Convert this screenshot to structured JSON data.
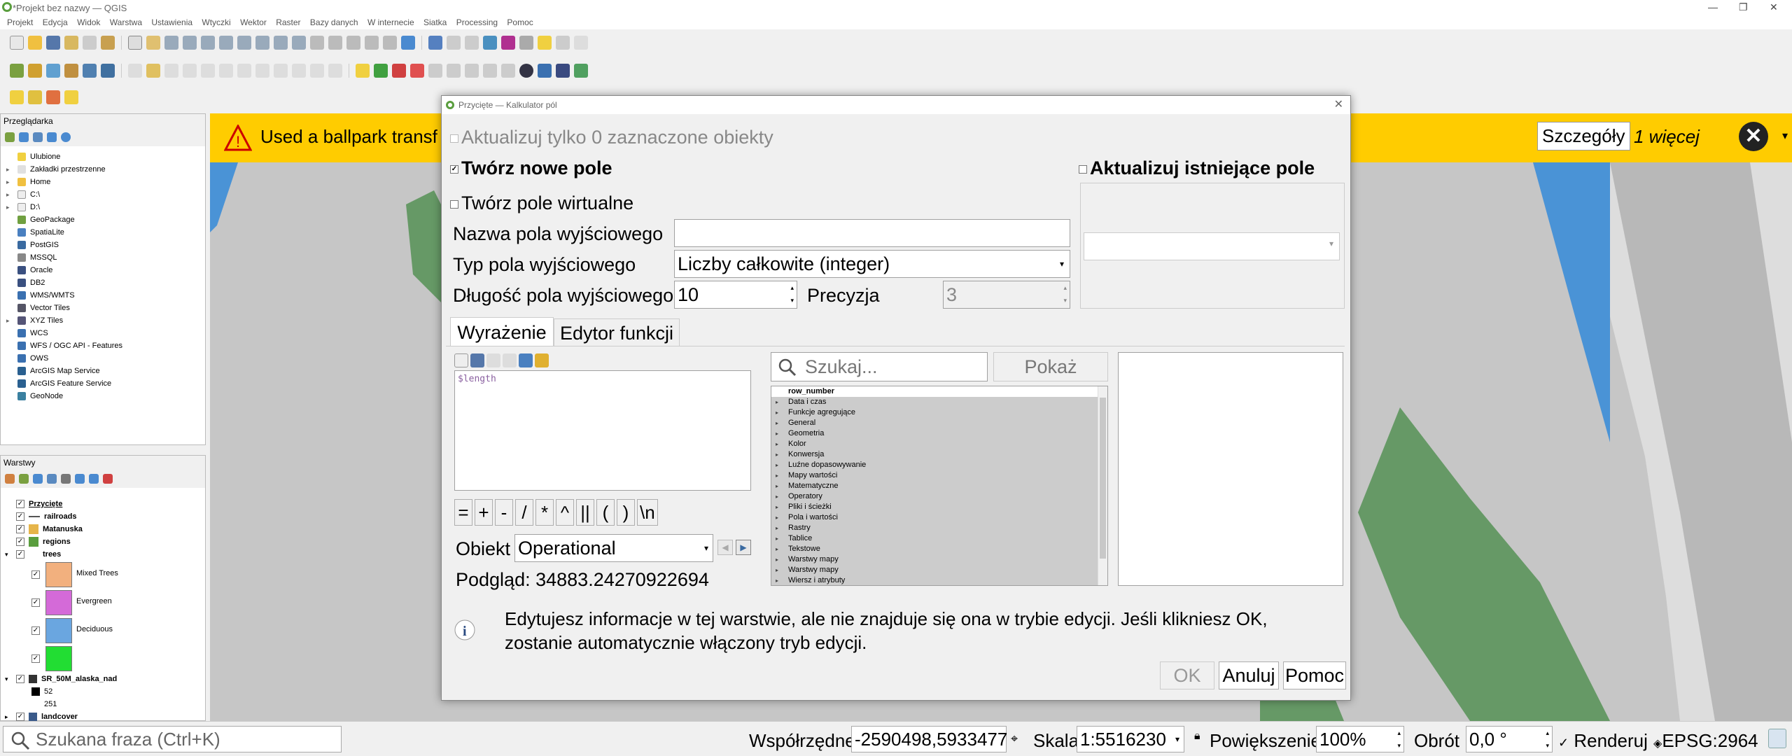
{
  "window": {
    "title": "*Projekt bez nazwy — QGIS"
  },
  "menu": [
    "Projekt",
    "Edycja",
    "Widok",
    "Warstwa",
    "Ustawienia",
    "Wtyczki",
    "Wektor",
    "Raster",
    "Bazy danych",
    "W internecie",
    "Siatka",
    "Processing",
    "Pomoc"
  ],
  "browser": {
    "title": "Przeglądarka",
    "items": [
      "Ulubione",
      "Zakładki przestrzenne",
      "Home",
      "C:\\",
      "D:\\",
      "GeoPackage",
      "SpatiaLite",
      "PostGIS",
      "MSSQL",
      "Oracle",
      "DB2",
      "WMS/WMTS",
      "Vector Tiles",
      "XYZ Tiles",
      "WCS",
      "WFS / OGC API - Features",
      "OWS",
      "ArcGIS Map Service",
      "ArcGIS Feature Service",
      "GeoNode"
    ]
  },
  "layers": {
    "title": "Warstwy",
    "items": [
      {
        "label": "Przycięte",
        "color": ""
      },
      {
        "label": "railroads",
        "color": ""
      },
      {
        "label": "Matanuska",
        "color": "#e6b54a"
      },
      {
        "label": "regions",
        "color": "#5a9e3e"
      },
      {
        "label": "trees",
        "color": ""
      }
    ],
    "legend": [
      {
        "label": "Mixed Trees",
        "color": "#f2b07e"
      },
      {
        "label": "Evergreen",
        "color": "#d46ad8"
      },
      {
        "label": "Deciduous",
        "color": "#6aa6e0"
      },
      {
        "label": "",
        "color": "#22dd33"
      }
    ],
    "raster": {
      "label": "SR_50M_alaska_nad",
      "v1": "52",
      "v2": "251"
    },
    "landcover": "landcover"
  },
  "banner": {
    "text": "Used a ballpark transf",
    "details_btn": "Szczegóły",
    "more": "1 więcej",
    "bg": "#ffcc00"
  },
  "dialog": {
    "title": "Przycięte — Kalkulator pól",
    "update_selected": "Aktualizuj tylko 0 zaznaczone obiekty",
    "create_new": "Twórz nowe pole",
    "update_existing": "Aktualizuj istniejące pole",
    "virtual": "Twórz pole wirtualne",
    "out_name_label": "Nazwa pola wyjściowego",
    "out_name_value": "",
    "out_type_label": "Typ pola wyjściowego",
    "out_type_value": "Liczby całkowite (integer)",
    "out_len_label": "Długość pola wyjściowego",
    "out_len_value": "10",
    "precision_label": "Precyzja",
    "precision_value": "3",
    "tab_expression": "Wyrażenie",
    "tab_editor": "Edytor funkcji",
    "expression": "$length",
    "operators": [
      "=",
      "+",
      "-",
      "/",
      "*",
      "^",
      "||",
      "(",
      ")",
      "\\n"
    ],
    "feature_label": "Obiekt",
    "feature_value": "Operational",
    "preview_label": "Podgląd:",
    "preview_value": "34883.24270922694",
    "search_placeholder": "Szukaj...",
    "show_help": "Pokaż pomoc",
    "functions": [
      "row_number",
      "Data i czas",
      "Funkcje agregujące",
      "General",
      "Geometria",
      "Kolor",
      "Konwersja",
      "Luźne dopasowywanie",
      "Mapy wartości",
      "Matematyczne",
      "Operatory",
      "Pliki i ścieżki",
      "Pola i wartości",
      "Rastry",
      "Tablice",
      "Tekstowe",
      "Warstwy mapy",
      "Warstwy mapy",
      "Wiersz i atrybuty"
    ],
    "info": "Edytujesz informacje w tej warstwie, ale nie znajduje się ona w trybie edycji. Jeśli klikniesz OK, zostanie automatycznie włączony tryb edycji.",
    "ok": "OK",
    "cancel": "Anuluj",
    "help": "Pomoc"
  },
  "status": {
    "search_placeholder": "Szukana fraza (Ctrl+K)",
    "coord_label": "Współrzędne",
    "coord_value": "-2590498,5933477",
    "scale_label": "Skala",
    "scale_value": "1:5516230",
    "zoom_label": "Powiększenie",
    "zoom_value": "100%",
    "rotation_label": "Obrót",
    "rotation_value": "0,0 °",
    "render_label": "Renderuj",
    "crs": "EPSG:2964"
  }
}
